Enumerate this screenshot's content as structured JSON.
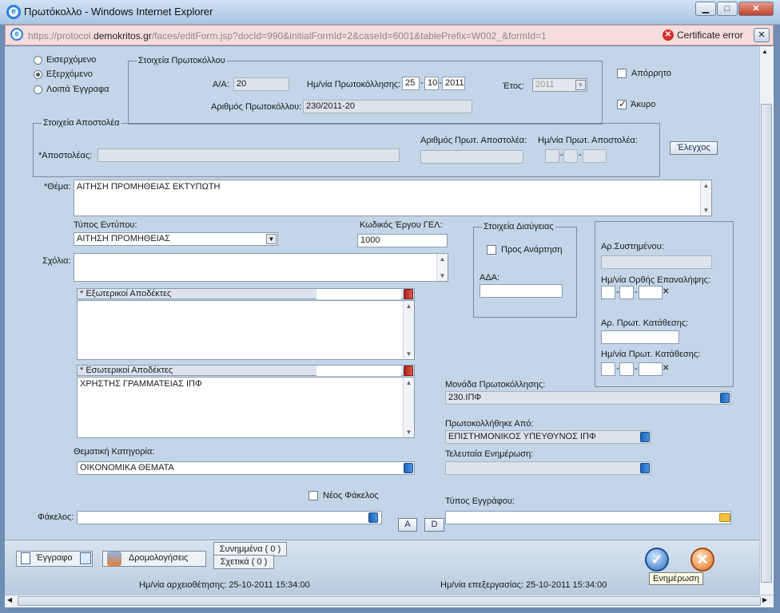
{
  "window": {
    "title": "Πρωτόκολλο - Windows Internet Explorer",
    "url_prefix": "https://protocol.",
    "url_domain": "demokritos.gr",
    "url_rest": "/faces/editForm.jsp?docId=990&initialFormId=2&caseId=6001&tablePrefix=W002_&formId=1",
    "cert_error": "Certificate error"
  },
  "direction": {
    "options": [
      "Εισερχόμενο",
      "Εξερχόμενο",
      "Λοιπά Έγγραφα"
    ],
    "selected": "Εξερχόμενο"
  },
  "protocol": {
    "legend": "Στοιχεία Πρωτοκόλλου",
    "aa_label": "Α/Α:",
    "aa_value": "20",
    "date_label": "Ημ/νία Πρωτοκόλλησης:",
    "date_day": "25",
    "date_month": "10",
    "date_year": "2011",
    "year_label": "Έτος:",
    "year_value": "2011",
    "number_label": "Αριθμός Πρωτοκόλλου:",
    "number_value": "230/2011-20"
  },
  "flags": {
    "aporrito": "Απόρρητο",
    "akyro": "Άκυρο",
    "aporrito_checked": false,
    "akyro_checked": true
  },
  "sender": {
    "legend": "Στοιχεία Αποστολέα",
    "sender_label": "*Αποστολέας:",
    "num_label": "Αριθμός Πρωτ. Αποστολέα:",
    "date_label": "Ημ/νία Πρωτ. Αποστολέα:",
    "check_button": "Έλεγχος"
  },
  "subject": {
    "label": "*Θέμα:",
    "value": "ΑΙΤΗΣΗ ΠΡΟΜΗΘΕΙΑΣ ΕΚΤΥΠΩΤΗ"
  },
  "form_type": {
    "label": "Τύπος Εντύπου:",
    "value": "ΑΙΤΗΣΗ ΠΡΟΜΗΘΕΙΑΣ"
  },
  "project_code": {
    "label": "Κωδικός Έργου ΓΕΛ:",
    "value": "1000"
  },
  "comments": {
    "label": "Σχόλια:"
  },
  "diavgeia": {
    "legend": "Στοιχεία Διαύγειας",
    "for_posting": "Προς Ανάρτηση",
    "ada_label": "ΑΔΑ:"
  },
  "right_box": {
    "attached_label": "Αρ.Συστημένου:",
    "delivery_date_label": "Ημ/νία Ορθής Επαναλήψης:",
    "deposit_num_label": "Αρ. Πρωτ. Κατάθεσης:",
    "deposit_date_label": "Ημ/νία Πρωτ. Κατάθεσης:"
  },
  "external_recipients": {
    "label": "* Εξωτερικοί Αποδέκτες"
  },
  "internal_recipients": {
    "label": "* Εσωτερικοί Αποδέκτες",
    "items": [
      "ΧΡΗΣΤΗΣ ΓΡΑΜΜΑΤΕΙΑΣ ΙΠΦ"
    ]
  },
  "unit": {
    "label": "Μονάδα Πρωτοκόλλησης:",
    "value": "230.ΙΠΦ"
  },
  "registered_by": {
    "label": "Πρωτοκολλήθηκε Από:",
    "value": "ΕΠΙΣΤΗΜΟΝΙΚΟΣ ΥΠΕΥΘΥΝΟΣ ΙΠΦ"
  },
  "last_update": {
    "label": "Τελευταία Ενημέρωση:"
  },
  "category": {
    "label": "Θεματική Κατηγορία:",
    "value": "ΟΙΚΟΝΟΜΙΚΑ ΘΕΜΑΤΑ"
  },
  "folder": {
    "new_label": "Νέος Φάκελος",
    "label": "Φάκελος:",
    "btn_a": "A",
    "btn_d": "D"
  },
  "doc_type": {
    "label": "Τύπος Εγγράφου:"
  },
  "bottom": {
    "document_tab": "Έγγραφο",
    "routing_tab": "Δρομολογήσεις",
    "attachments": "Συνημμένα ( 0 )",
    "related": "Σχετικά ( 0 )",
    "update_tooltip": "Ενημέρωση"
  },
  "status": {
    "archived": "Ημ/νία αρχειοθέτησης: 25-10-2011 15:34:00",
    "edited": "Ημ/νία επεξεργασίας: 25-10-2011 15:34:00"
  }
}
